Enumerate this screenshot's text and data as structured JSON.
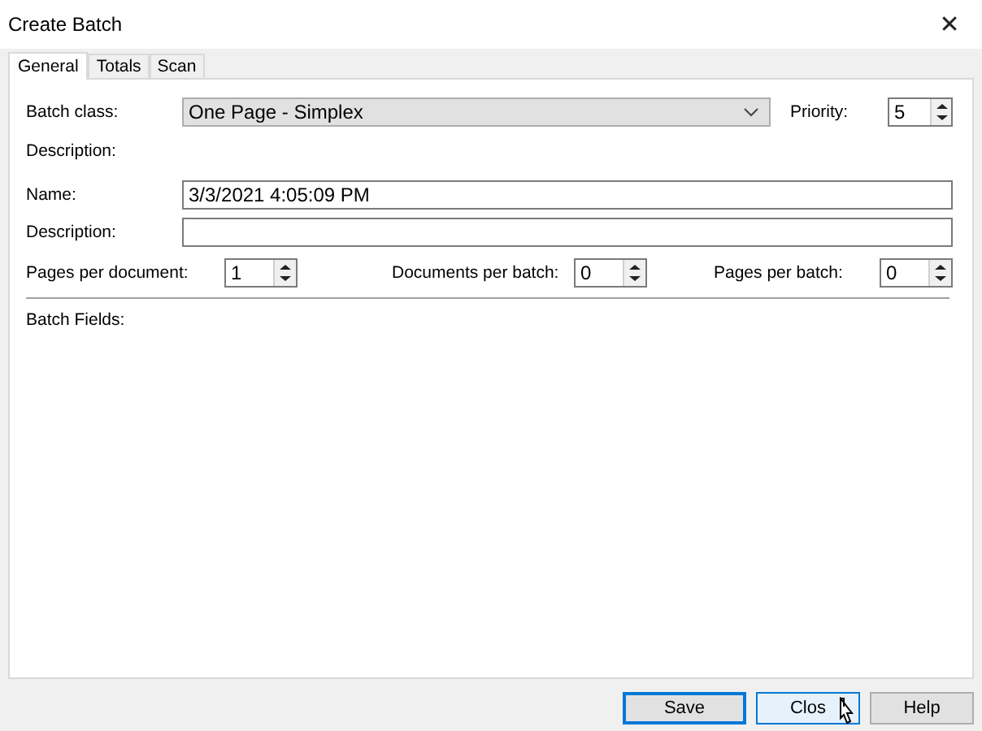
{
  "window": {
    "title": "Create Batch",
    "close_glyph": "✕"
  },
  "tabs": [
    {
      "label": "General",
      "selected": true
    },
    {
      "label": "Totals",
      "selected": false
    },
    {
      "label": "Scan",
      "selected": false
    }
  ],
  "batch_class": {
    "label": "Batch class:",
    "value": "One Page - Simplex"
  },
  "priority": {
    "label": "Priority:",
    "value": "5"
  },
  "batch_class_description": {
    "label": "Description:"
  },
  "name": {
    "label": "Name:",
    "value": "3/3/2021 4:05:09 PM"
  },
  "description": {
    "label": "Description:"
  },
  "counts": [
    {
      "label": "Pages per document:",
      "value": "1"
    },
    {
      "label": "Documents per batch:",
      "value": "0"
    },
    {
      "label": "Pages per batch:",
      "value": "0"
    }
  ],
  "batch_fields": {
    "label": "Batch Fields:"
  },
  "buttons": [
    {
      "label": "Save",
      "default": true,
      "hovered": false
    },
    {
      "label": "Clos",
      "default": false,
      "hovered": true
    },
    {
      "label": "Help",
      "default": false,
      "hovered": false
    }
  ]
}
